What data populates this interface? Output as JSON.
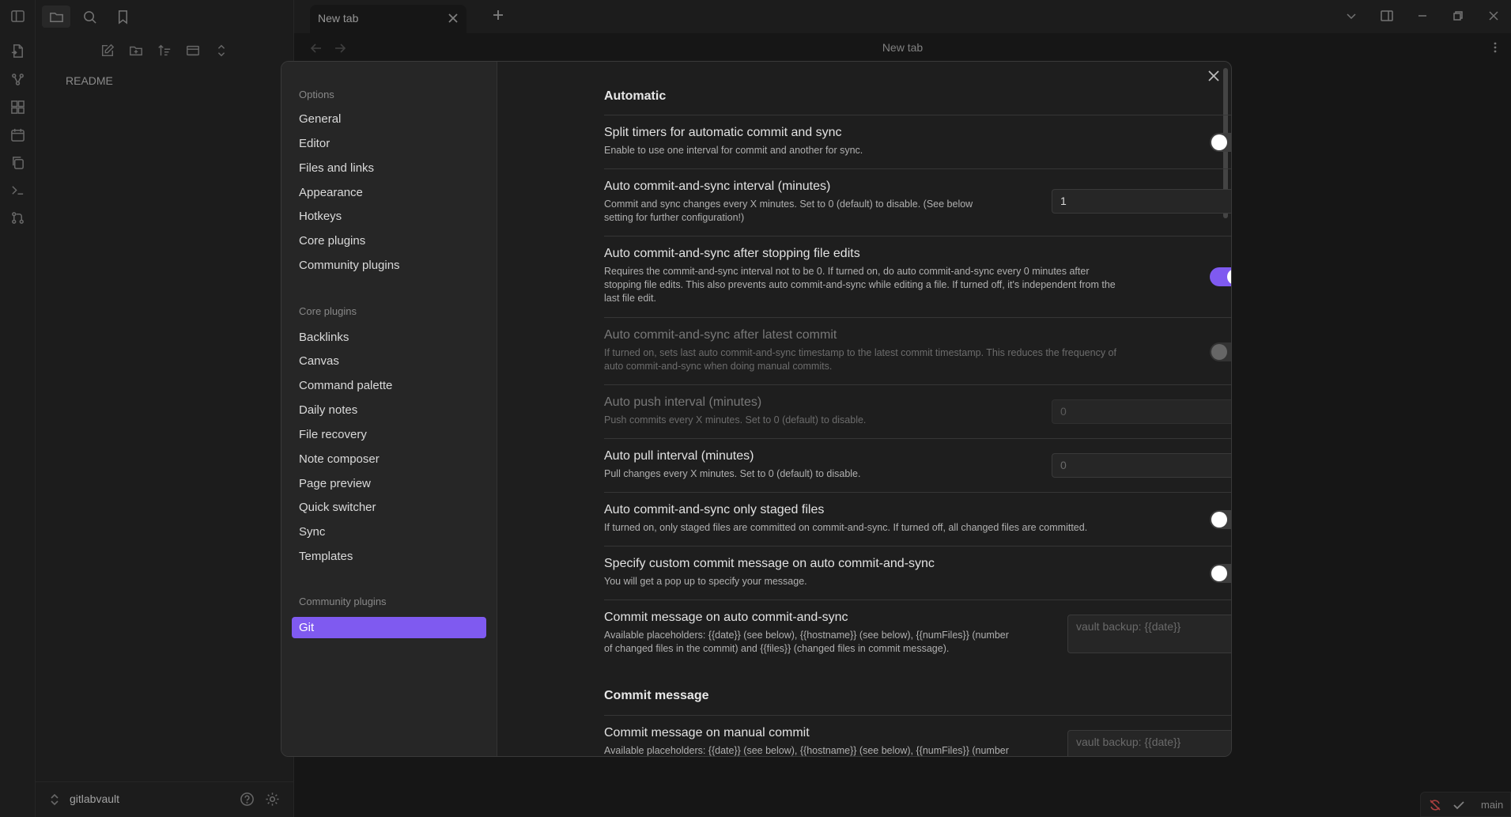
{
  "app": {
    "colors": {
      "accent": "#7f5af0",
      "background": "#1e1e1e",
      "sidebar": "#262626"
    }
  },
  "ribbon": {
    "icons": [
      "files-icon",
      "graph-icon",
      "blocks-icon",
      "calendar-icon",
      "copy-icon",
      "terminal-icon",
      "git-icon"
    ]
  },
  "left_pane": {
    "file_items": [
      "README"
    ],
    "vault_name": "gitlabvault"
  },
  "tabs": {
    "active_title": "New tab"
  },
  "navbar": {
    "title": "New tab"
  },
  "status_bar": {
    "branch": "main"
  },
  "settings_modal": {
    "options_group": "Options",
    "options_items": [
      "General",
      "Editor",
      "Files and links",
      "Appearance",
      "Hotkeys",
      "Core plugins",
      "Community plugins"
    ],
    "core_group": "Core plugins",
    "core_items": [
      "Backlinks",
      "Canvas",
      "Command palette",
      "Daily notes",
      "File recovery",
      "Note composer",
      "Page preview",
      "Quick switcher",
      "Sync",
      "Templates"
    ],
    "community_group": "Community plugins",
    "community_items": [
      "Git"
    ],
    "selected": "Git",
    "section_automatic": "Automatic",
    "section_commit_message": "Commit message",
    "settings": [
      {
        "name": "Split timers for automatic commit and sync",
        "desc": "Enable to use one interval for commit and another for sync.",
        "control": "toggle",
        "on": false
      },
      {
        "name": "Auto commit-and-sync interval (minutes)",
        "desc1": "Commit and sync changes every X minutes. Set to 0 (default) to disable. (See below",
        "desc2": "setting for further configuration!)",
        "control": "input",
        "value": "1"
      },
      {
        "name": "Auto commit-and-sync after stopping file edits",
        "desc1": "Requires the commit-and-sync interval not to be 0. If turned on, do auto commit-and-sync every 0 minutes after",
        "desc2": "stopping file edits. This also prevents auto commit-and-sync while editing a file. If turned off, it's independent from the",
        "desc3": "last file edit.",
        "control": "toggle",
        "on": true
      },
      {
        "name": "Auto commit-and-sync after latest commit",
        "desc1": "If turned on, sets last auto commit-and-sync timestamp to the latest commit timestamp. This reduces the frequency of",
        "desc2": "auto commit-and-sync when doing manual commits.",
        "control": "toggle",
        "on": false,
        "disabled": true
      },
      {
        "name": "Auto push interval (minutes)",
        "desc": "Push commits every X minutes. Set to 0 (default) to disable.",
        "control": "input",
        "placeholder": "0",
        "disabled": true
      },
      {
        "name": "Auto pull interval (minutes)",
        "desc": "Pull changes every X minutes. Set to 0 (default) to disable.",
        "control": "input",
        "placeholder": "0"
      },
      {
        "name": "Auto commit-and-sync only staged files",
        "desc": "If turned on, only staged files are committed on commit-and-sync. If turned off, all changed files are committed.",
        "control": "toggle",
        "on": false
      },
      {
        "name": "Specify custom commit message on auto commit-and-sync",
        "desc": "You will get a pop up to specify your message.",
        "control": "toggle",
        "on": false
      },
      {
        "name": "Commit message on auto commit-and-sync",
        "desc1": "Available placeholders: {{date}} (see below), {{hostname}} (see below), {{numFiles}} (number",
        "desc2": "of changed files in the commit) and {{files}} (changed files in commit message).",
        "control": "textarea",
        "placeholder": "vault backup: {{date}}"
      },
      {
        "name": "Commit message on manual commit",
        "desc1": "Available placeholders: {{date}} (see below), {{hostname}} (see below), {{numFiles}} (number",
        "control": "textarea",
        "placeholder": "vault backup: {{date}}"
      }
    ]
  }
}
